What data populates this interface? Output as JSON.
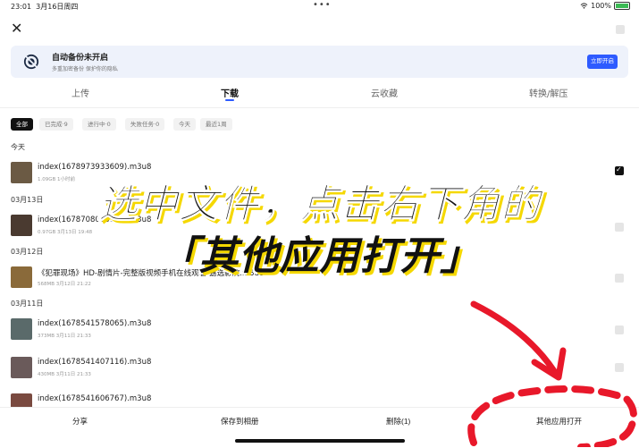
{
  "status": {
    "time": "23:01",
    "date": "3月16日周四",
    "battery": "100%"
  },
  "banner": {
    "title": "自动备份未开启",
    "subtitle": "多重加密备份 保护你的隐私",
    "button": "立即开启"
  },
  "tabs": [
    {
      "label": "上传",
      "active": false
    },
    {
      "label": "下载",
      "active": true
    },
    {
      "label": "云收藏",
      "active": false
    },
    {
      "label": "转换/解压",
      "active": false
    }
  ],
  "filters": [
    {
      "label": "全部",
      "active": true
    },
    {
      "label": "已完成·9",
      "active": false
    },
    {
      "label": "进行中·0",
      "active": false
    },
    {
      "label": "失败任务·0",
      "active": false
    },
    {
      "label": "今天",
      "active": false
    },
    {
      "label": "最近1周",
      "active": false
    }
  ],
  "sections": [
    {
      "label": "今天"
    },
    {
      "label": "03月13日"
    },
    {
      "label": "03月12日"
    },
    {
      "label": "03月11日"
    }
  ],
  "files": [
    {
      "name": "index(1678973933609).m3u8",
      "meta": "1.09GB  1小时前",
      "checked": true,
      "thumb_color": "#6b5a44"
    },
    {
      "name": "index(1678708053867).m3u8",
      "meta": "0.97GB  3月13日 19:48",
      "checked": false,
      "thumb_color": "#4a3a30"
    },
    {
      "name": "《犯罪现场》HD-剧情片-完整版视频手机在线观看-嘉选影院.m3u8",
      "meta": "568MB  3月12日 21:22",
      "checked": false,
      "thumb_color": "#8a6a3a"
    },
    {
      "name": "index(1678541578065).m3u8",
      "meta": "373MB  3月11日 21:33",
      "checked": false,
      "thumb_color": "#5a6a6a"
    },
    {
      "name": "index(1678541407116).m3u8",
      "meta": "430MB  3月11日 21:33",
      "checked": false,
      "thumb_color": "#6a5a5a"
    },
    {
      "name": "index(1678541606767).m3u8",
      "meta": "",
      "checked": false,
      "thumb_color": "#7a4a40"
    }
  ],
  "overlay": {
    "line1": "选中文件，点击右下角的",
    "line2": "「其他应用打开」"
  },
  "bottom": {
    "share": "分享",
    "save_album": "保存到相册",
    "delete": "删除(1)",
    "open_other": "其他应用打开"
  },
  "colors": {
    "accent": "#2e5bff",
    "annotation": "#e8182a",
    "highlight": "#f5d800"
  }
}
